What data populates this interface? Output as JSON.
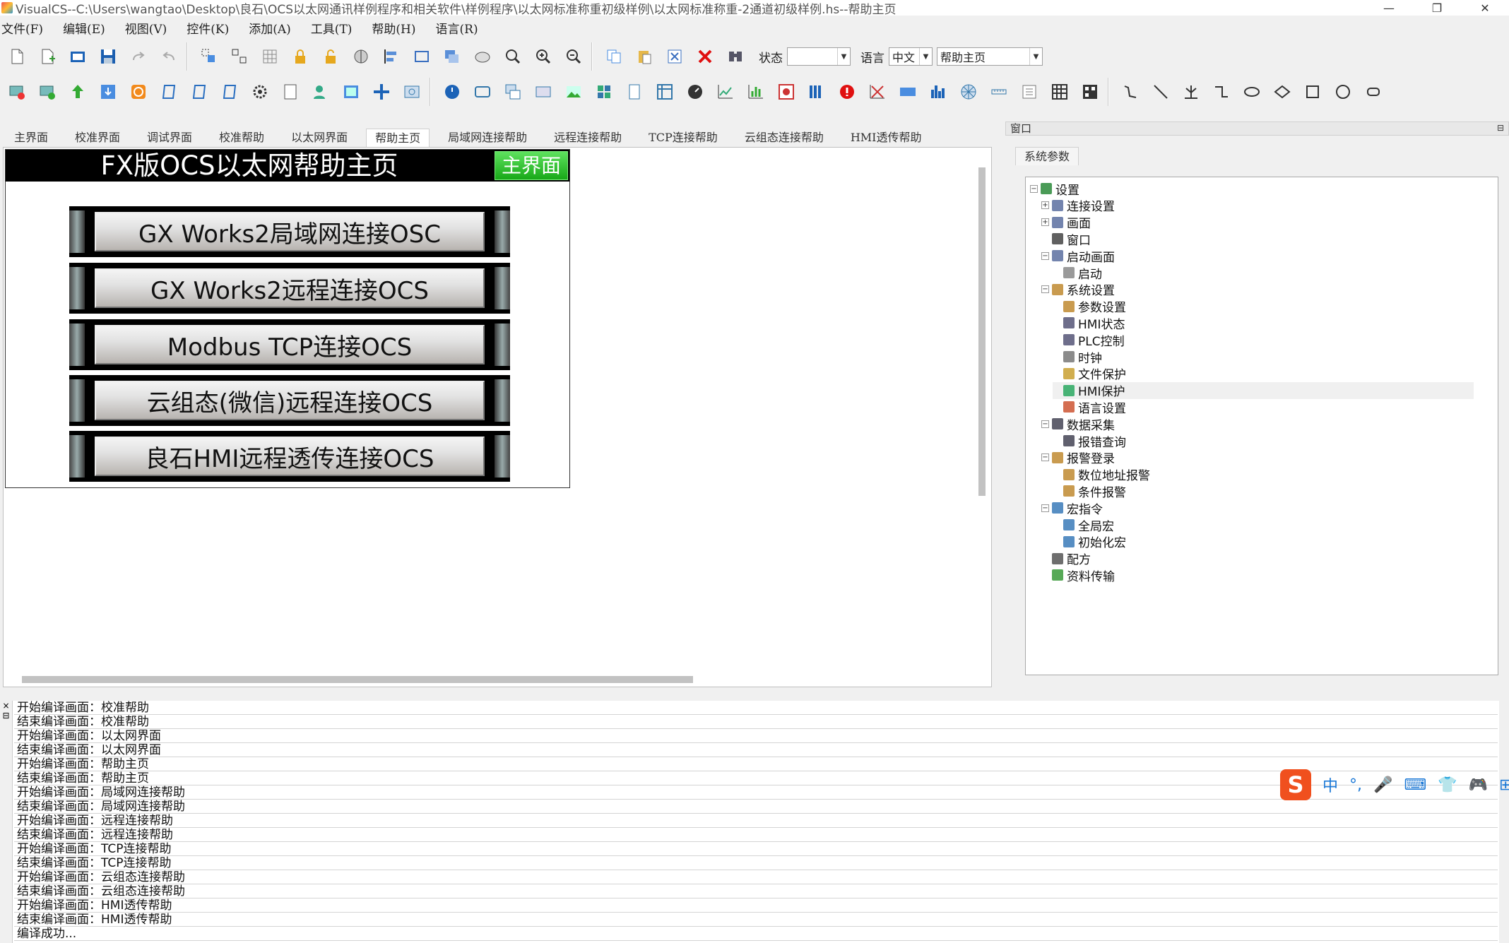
{
  "window": {
    "title": "VisualCS--C:\\Users\\wangtao\\Desktop\\良石\\OCS以太网通讯样例程序和相关软件\\样例程序\\以太网标准称重初级样例\\以太网标准称重-2通道初级样例.hs--帮助主页",
    "minimize": "—",
    "restore": "❐",
    "close": "✕"
  },
  "menu": [
    "文件(F)",
    "编辑(E)",
    "视图(V)",
    "控件(K)",
    "添加(A)",
    "工具(T)",
    "帮助(H)",
    "语言(R)"
  ],
  "toolbar1": {
    "status_label": "状态",
    "status_value": "",
    "language_label": "语言",
    "language_value": "中文",
    "screen_value": "帮助主页"
  },
  "tabs": [
    "主界面",
    "校准界面",
    "调试界面",
    "校准帮助",
    "以太网界面",
    "帮助主页",
    "局域网连接帮助",
    "远程连接帮助",
    "TCP连接帮助",
    "云组态连接帮助",
    "HMI透传帮助"
  ],
  "active_tab": "帮助主页",
  "screen": {
    "title": "FX版OCS以太网帮助主页",
    "main_button": "主界面",
    "buttons": [
      "GX Works2局域网连接OSC",
      "GX Works2远程连接OCS",
      "Modbus TCP连接OCS",
      "云组态(微信)远程连接OCS",
      "良石HMI远程透传连接OCS"
    ]
  },
  "panel": {
    "header": "窗口",
    "tab": "系统参数",
    "tree": [
      {
        "label": "设置",
        "level": 0,
        "exp": "⊟"
      },
      {
        "label": "连接设置",
        "level": 1,
        "exp": "⊞"
      },
      {
        "label": "画面",
        "level": 1,
        "exp": "⊞"
      },
      {
        "label": "窗口",
        "level": 1,
        "exp": ""
      },
      {
        "label": "启动画面",
        "level": 1,
        "exp": "⊟"
      },
      {
        "label": "启动",
        "level": 2,
        "exp": ""
      },
      {
        "label": "系统设置",
        "level": 1,
        "exp": "⊟"
      },
      {
        "label": "参数设置",
        "level": 2,
        "exp": ""
      },
      {
        "label": "HMI状态",
        "level": 2,
        "exp": ""
      },
      {
        "label": "PLC控制",
        "level": 2,
        "exp": ""
      },
      {
        "label": "时钟",
        "level": 2,
        "exp": ""
      },
      {
        "label": "文件保护",
        "level": 2,
        "exp": ""
      },
      {
        "label": "HMI保护",
        "level": 2,
        "exp": "",
        "selected": true
      },
      {
        "label": "语言设置",
        "level": 2,
        "exp": ""
      },
      {
        "label": "数据采集",
        "level": 1,
        "exp": "⊟"
      },
      {
        "label": "报错查询",
        "level": 2,
        "exp": ""
      },
      {
        "label": "报警登录",
        "level": 1,
        "exp": "⊟"
      },
      {
        "label": "数位地址报警",
        "level": 2,
        "exp": ""
      },
      {
        "label": "条件报警",
        "level": 2,
        "exp": ""
      },
      {
        "label": "宏指令",
        "level": 1,
        "exp": "⊟"
      },
      {
        "label": "全局宏",
        "level": 2,
        "exp": ""
      },
      {
        "label": "初始化宏",
        "level": 2,
        "exp": ""
      },
      {
        "label": "配方",
        "level": 1,
        "exp": ""
      },
      {
        "label": "资料传输",
        "level": 1,
        "exp": ""
      }
    ]
  },
  "output": {
    "lines": [
      "开始编译画面：校准帮助",
      "结束编译画面：校准帮助",
      "开始编译画面：以太网界面",
      "结束编译画面：以太网界面",
      "开始编译画面：帮助主页",
      "结束编译画面：帮助主页",
      "开始编译画面：局域网连接帮助",
      "结束编译画面：局域网连接帮助",
      "开始编译画面：远程连接帮助",
      "结束编译画面：远程连接帮助",
      "开始编译画面：TCP连接帮助",
      "结束编译画面：TCP连接帮助",
      "开始编译画面：云组态连接帮助",
      "结束编译画面：云组态连接帮助",
      "开始编译画面：HMI透传帮助",
      "结束编译画面：HMI透传帮助",
      "编译成功..."
    ]
  },
  "ime": {
    "logo": "S",
    "items": [
      "中",
      "°,",
      "🎤",
      "⌨",
      "👕",
      "🎮",
      "⊞",
      "♻"
    ]
  },
  "colors": {
    "main_button": "#22b022",
    "screen_header": "#000000",
    "accent": "#1b78d6"
  }
}
